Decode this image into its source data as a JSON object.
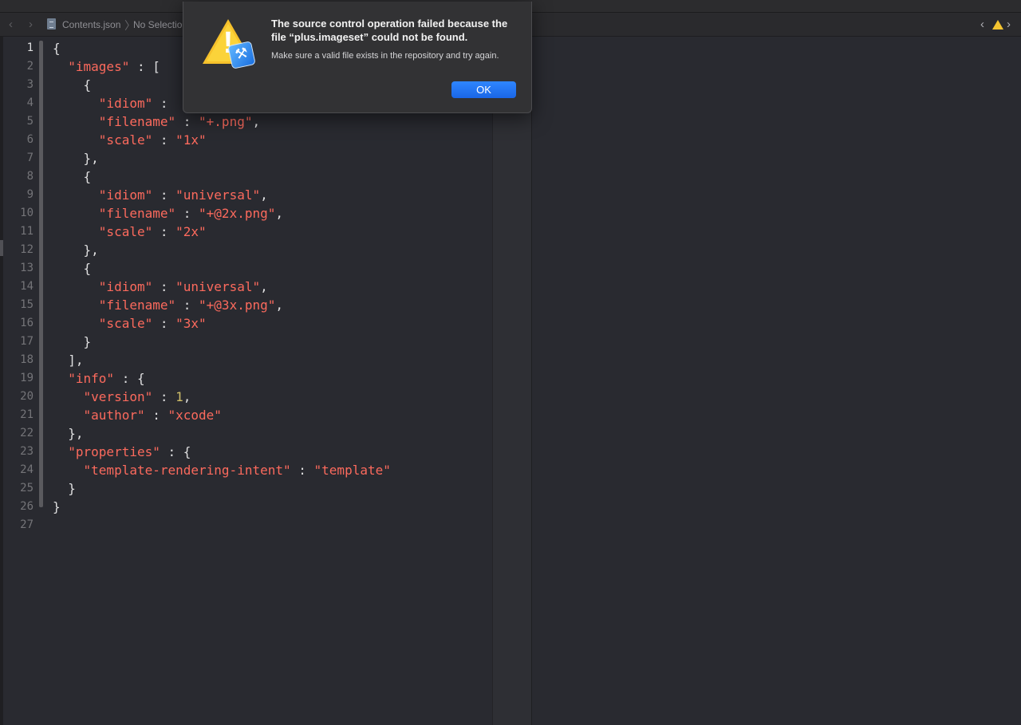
{
  "jumpbar": {
    "back": "‹",
    "forward": "›",
    "file": "Contents.json",
    "separator": "〉",
    "selection": "No Selection",
    "issue_prev": "‹",
    "issue_next": "›"
  },
  "editor": {
    "current_line": 1,
    "line_numbers": [
      "1",
      "2",
      "3",
      "4",
      "5",
      "6",
      "7",
      "8",
      "9",
      "10",
      "11",
      "12",
      "13",
      "14",
      "15",
      "16",
      "17",
      "18",
      "19",
      "20",
      "21",
      "22",
      "23",
      "24",
      "25",
      "26",
      "27"
    ],
    "lines": [
      [
        {
          "t": "{",
          "c": "p"
        }
      ],
      [
        {
          "t": "  ",
          "c": "p"
        },
        {
          "t": "\"images\"",
          "c": "s"
        },
        {
          "t": " : [",
          "c": "p"
        }
      ],
      [
        {
          "t": "    {",
          "c": "p"
        }
      ],
      [
        {
          "t": "      ",
          "c": "p"
        },
        {
          "t": "\"idiom\"",
          "c": "s"
        },
        {
          "t": " : ",
          "c": "p"
        }
      ],
      [
        {
          "t": "      ",
          "c": "p"
        },
        {
          "t": "\"filename\"",
          "c": "s"
        },
        {
          "t": " : ",
          "c": "p"
        },
        {
          "t": "\"+.png\"",
          "c": "s"
        },
        {
          "t": ",",
          "c": "p"
        }
      ],
      [
        {
          "t": "      ",
          "c": "p"
        },
        {
          "t": "\"scale\"",
          "c": "s"
        },
        {
          "t": " : ",
          "c": "p"
        },
        {
          "t": "\"1x\"",
          "c": "s"
        }
      ],
      [
        {
          "t": "    },",
          "c": "p"
        }
      ],
      [
        {
          "t": "    {",
          "c": "p"
        }
      ],
      [
        {
          "t": "      ",
          "c": "p"
        },
        {
          "t": "\"idiom\"",
          "c": "s"
        },
        {
          "t": " : ",
          "c": "p"
        },
        {
          "t": "\"universal\"",
          "c": "s"
        },
        {
          "t": ",",
          "c": "p"
        }
      ],
      [
        {
          "t": "      ",
          "c": "p"
        },
        {
          "t": "\"filename\"",
          "c": "s"
        },
        {
          "t": " : ",
          "c": "p"
        },
        {
          "t": "\"+@2x.png\"",
          "c": "s"
        },
        {
          "t": ",",
          "c": "p"
        }
      ],
      [
        {
          "t": "      ",
          "c": "p"
        },
        {
          "t": "\"scale\"",
          "c": "s"
        },
        {
          "t": " : ",
          "c": "p"
        },
        {
          "t": "\"2x\"",
          "c": "s"
        }
      ],
      [
        {
          "t": "    },",
          "c": "p"
        }
      ],
      [
        {
          "t": "    {",
          "c": "p"
        }
      ],
      [
        {
          "t": "      ",
          "c": "p"
        },
        {
          "t": "\"idiom\"",
          "c": "s"
        },
        {
          "t": " : ",
          "c": "p"
        },
        {
          "t": "\"universal\"",
          "c": "s"
        },
        {
          "t": ",",
          "c": "p"
        }
      ],
      [
        {
          "t": "      ",
          "c": "p"
        },
        {
          "t": "\"filename\"",
          "c": "s"
        },
        {
          "t": " : ",
          "c": "p"
        },
        {
          "t": "\"+@3x.png\"",
          "c": "s"
        },
        {
          "t": ",",
          "c": "p"
        }
      ],
      [
        {
          "t": "      ",
          "c": "p"
        },
        {
          "t": "\"scale\"",
          "c": "s"
        },
        {
          "t": " : ",
          "c": "p"
        },
        {
          "t": "\"3x\"",
          "c": "s"
        }
      ],
      [
        {
          "t": "    }",
          "c": "p"
        }
      ],
      [
        {
          "t": "  ],",
          "c": "p"
        }
      ],
      [
        {
          "t": "  ",
          "c": "p"
        },
        {
          "t": "\"info\"",
          "c": "s"
        },
        {
          "t": " : {",
          "c": "p"
        }
      ],
      [
        {
          "t": "    ",
          "c": "p"
        },
        {
          "t": "\"version\"",
          "c": "s"
        },
        {
          "t": " : ",
          "c": "p"
        },
        {
          "t": "1",
          "c": "n"
        },
        {
          "t": ",",
          "c": "p"
        }
      ],
      [
        {
          "t": "    ",
          "c": "p"
        },
        {
          "t": "\"author\"",
          "c": "s"
        },
        {
          "t": " : ",
          "c": "p"
        },
        {
          "t": "\"xcode\"",
          "c": "s"
        }
      ],
      [
        {
          "t": "  },",
          "c": "p"
        }
      ],
      [
        {
          "t": "  ",
          "c": "p"
        },
        {
          "t": "\"properties\"",
          "c": "s"
        },
        {
          "t": " : {",
          "c": "p"
        }
      ],
      [
        {
          "t": "    ",
          "c": "p"
        },
        {
          "t": "\"template-rendering-intent\"",
          "c": "s"
        },
        {
          "t": " : ",
          "c": "p"
        },
        {
          "t": "\"template\"",
          "c": "s"
        }
      ],
      [
        {
          "t": "  }",
          "c": "p"
        }
      ],
      [
        {
          "t": "}",
          "c": "p"
        }
      ],
      [
        {
          "t": "",
          "c": "p"
        }
      ]
    ]
  },
  "alert": {
    "title": "The source control operation failed because the file “plus.imageset” could not be found.",
    "message": "Make sure a valid file exists in the repository and try again.",
    "ok_label": "OK",
    "icon": "warning-triangle-with-xcode-badge"
  },
  "colors": {
    "string": "#fc6a5d",
    "number": "#d0bf69",
    "plain": "#dfdfe0",
    "editor_bg": "#292a30",
    "accent": "#1a66e6",
    "warning": "#f6c12b"
  }
}
